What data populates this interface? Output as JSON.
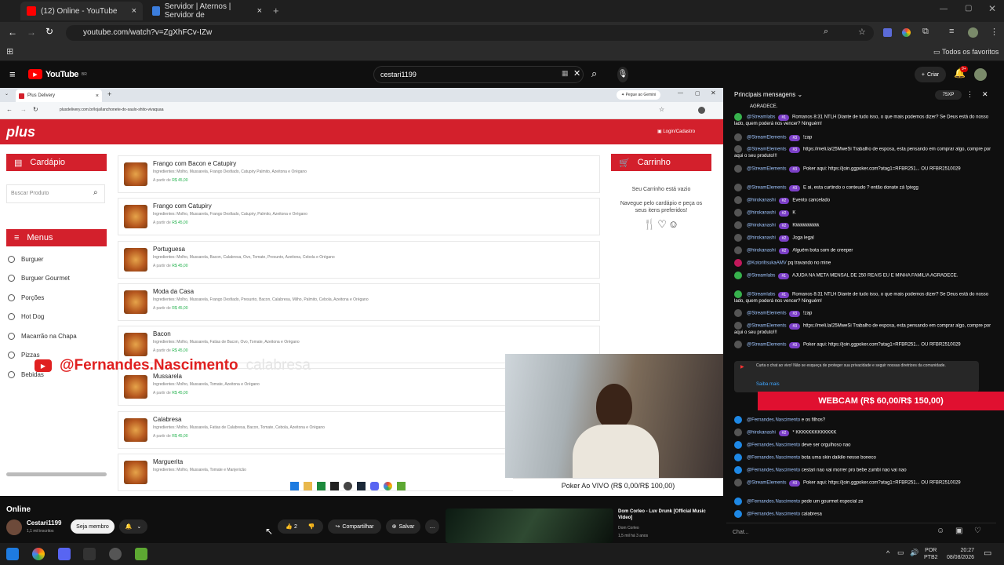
{
  "browser": {
    "tabs": [
      {
        "label": "(12) Online - YouTube",
        "color": "#ff0000"
      },
      {
        "label": "Servidor | Aternos | Servidor de",
        "color": "#3b7ddd"
      }
    ],
    "url": "youtube.com/watch?v=ZgXhFCv-IZw",
    "bookmarks_label": "Todos os favoritos"
  },
  "youtube": {
    "logo": "YouTube",
    "region": "BR",
    "search_value": "cestari1199",
    "create_label": "Criar",
    "notif_count": "9+"
  },
  "inner": {
    "tab_label": "Plus Delivery",
    "gemini": "Pegue ao Gemini",
    "url": "plusdelivery.com.br/loja/lanchonete-do-saulo-shito-vivaquaa",
    "login": "Login/Cadastro",
    "logo": "plus",
    "cardapio": "Cardápio",
    "search_placeholder": "Buscar Produto",
    "menus": "Menus",
    "menu_items": [
      "Burguer",
      "Burguer Gourmet",
      "Porções",
      "Hot Dog",
      "Macarrão na Chapa",
      "Pizzas",
      "Bebidas"
    ],
    "carrinho": "Carrinho",
    "cart_empty": "Seu Carrinho está vazio",
    "cart_hint": "Navegue pelo cardápio e peça os seus itens preferidos!",
    "products": [
      {
        "name": "Frango com Bacon e Catupiry",
        "desc": "Ingredientes: Molho, Mussarela, Frango Desfiado, Catupiry Palmito, Azeitona e Orégano",
        "price": "R$ 45,00"
      },
      {
        "name": "Frango com Catupiry",
        "desc": "Ingredientes: Molho, Mussarela, Frango Desfiado, Catupiry, Palmito, Azeitona e Orégano",
        "price": "R$ 45,00"
      },
      {
        "name": "Portuguesa",
        "desc": "Ingredientes: Molho, Mussarela, Bacon, Calabresa, Ovo, Tomate, Presunto, Azeitona, Cebola e Orégano",
        "price": "R$ 45,00"
      },
      {
        "name": "Moda da Casa",
        "desc": "Ingredientes: Molho, Mussarela, Frango Desfiado, Presunto, Bacon, Calabresa, Milho, Palmito, Cebola, Azeitona e Orégano",
        "price": "R$ 45,00"
      },
      {
        "name": "Bacon",
        "desc": "Ingredientes: Molho, Mussarela, Fatias de Bacon, Ovo, Tomate, Azeitona e Orégano",
        "price": "R$ 45,00"
      },
      {
        "name": "Mussarela",
        "desc": "Ingredientes: Molho, Mussarela, Tomate, Azeitona e Orégano",
        "price": "R$ 45,00"
      },
      {
        "name": "Calabresa",
        "desc": "Ingredientes: Molho, Mussarela, Fatias de Calabresa, Bacon, Tomate, Cebola, Azeitona e Orégano",
        "price": "R$ 45,00"
      },
      {
        "name": "Marguerita",
        "desc": "Ingredientes: Molho, Mussarela, Tomate e Manjericão",
        "price": ""
      }
    ],
    "price_prefix": "A partir de",
    "watermark": "@Fernandes.Nascimento",
    "watermark_faded": "calabresa",
    "poker_banner": "Poker Ao VIVO (R$ 0,00/R$ 100,00)"
  },
  "chat": {
    "header": "Principais mensagens",
    "xp": "75XP",
    "messages": [
      {
        "author": "",
        "badge": "",
        "text": "AGRADECE."
      },
      {
        "author": "@Streamlabs",
        "badge": "#1",
        "text": "Romanos 8:31 NTLH Diante de tudo isso, o que mais podemos dizer? Se Deus está do nosso lado, quem poderá nos vencer? Ninguém!"
      },
      {
        "author": "@StreamElements",
        "badge": "#3",
        "text": "!zap"
      },
      {
        "author": "@StreamElements",
        "badge": "#3",
        "text": "https://meli.la/25MweSi Trabalho de esposa, esta pensando em comprar algo, compre por aqui o seu produto!!!"
      },
      {
        "author": "@StreamElements",
        "badge": "#3",
        "text": "Poker aqui: https://join.ggpoker.com?atag1=RFBR251... OU RFBR2510029"
      },
      {
        "author": "@StreamElements",
        "badge": "#3",
        "text": "E ai, esta curtindo o conteudo ? então donate zá !pixgg"
      },
      {
        "author": "@hirokanashi",
        "badge": "#2",
        "text": "Evento cancelado"
      },
      {
        "author": "@hirokanashi",
        "badge": "#2",
        "text": "K"
      },
      {
        "author": "@hirokanashi",
        "badge": "#2",
        "text": "Kkkkkkkkkkk"
      },
      {
        "author": "@hirokanashi",
        "badge": "#2",
        "text": "Joga legal"
      },
      {
        "author": "@hirokanashi",
        "badge": "#2",
        "text": "Alguém bota som de creeper"
      },
      {
        "author": "@KotoriItsukaAMV",
        "badge": "",
        "text": "pq travando no mine"
      },
      {
        "author": "@Streamlabs",
        "badge": "#1",
        "text": "AJUDA NA META MENSAL DE 250 REAIS EU E MINHA FAMILIA AGRADECE."
      },
      {
        "author": "@Streamlabs",
        "badge": "#1",
        "text": "Romanos 8:31 NTLH Diante de tudo isso, o que mais podemos dizer? Se Deus está do nosso lado, quem poderá nos vencer? Ninguém!"
      },
      {
        "author": "@StreamElements",
        "badge": "#3",
        "text": "!zap"
      },
      {
        "author": "@StreamElements",
        "badge": "#3",
        "text": "https://meli.la/25MweSi Trabalho de esposa, esta pensando em comprar algo, compre por aqui o seu produto!!!"
      },
      {
        "author": "@StreamElements",
        "badge": "#3",
        "text": "Poker aqui: https://join.ggpoker.com?atag1=RFBR251... OU RFBR2510029"
      }
    ],
    "notice": "Curta o chat ao vivo! Não se esqueça de proteger sua privacidade e seguir nossas diretrizes da comunidade.",
    "notice_link": "Saiba mais",
    "webcam_banner": "WEBCAM (R$ 60,00/R$ 150,00)",
    "messages2": [
      {
        "author": "@Fernandes.Nascimento",
        "badge": "",
        "text": "e os filhos?"
      },
      {
        "author": "@hirokanashi",
        "badge": "#2",
        "text": "* KKKKKKKKKKKKK"
      },
      {
        "author": "@Fernandes.Nascimento",
        "badge": "",
        "text": "deve ser orgulhoso nao"
      },
      {
        "author": "@Fernandes.Nascimento",
        "badge": "",
        "text": "bota uma skin daikile nesse boneco"
      },
      {
        "author": "@Fernandes.Nascimento",
        "badge": "",
        "text": "cestari nao vai morrer pro bebe zumbi nao vai nao"
      },
      {
        "author": "@StreamElements",
        "badge": "#3",
        "text": "Poker aqui: https://join.ggpoker.com?atag1=RFBR251... OU RFBR2510029"
      },
      {
        "author": "@Fernandes.Nascimento",
        "badge": "",
        "text": "pede um gourmet especial ze"
      },
      {
        "author": "@Fernandes.Nascimento",
        "badge": "",
        "text": "calabresa"
      }
    ],
    "input_placeholder": "Chat..."
  },
  "video_info": {
    "title": "Online",
    "channel": "Cestari1199",
    "subs": "1,1 mil inscritos",
    "member": "Seja membro",
    "likes": "2",
    "share": "Compartilhar",
    "save": "Salvar"
  },
  "recommend": {
    "title": "Dom Corleo - Luv Drunk [Official Music Video]",
    "channel": "Dom Corleo",
    "meta": "1,5 mil  há 3 anos"
  },
  "taskbar": {
    "lang": "POR",
    "lang2": "PTB2",
    "time": "20:27",
    "date": "08/08/2026"
  }
}
